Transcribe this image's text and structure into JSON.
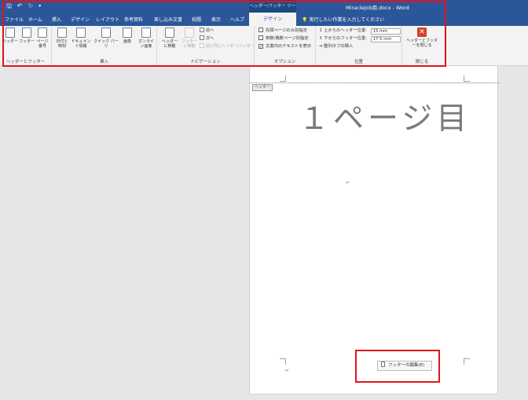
{
  "title_bar": {
    "context_tools_title": "ヘッダー/フッター ツール",
    "document_title": "MiracleJob用.docx  -  Word"
  },
  "tabs": [
    {
      "label": "ファイル"
    },
    {
      "label": "ホーム"
    },
    {
      "label": "挿入"
    },
    {
      "label": "デザイン"
    },
    {
      "label": "レイアウト"
    },
    {
      "label": "参考資料"
    },
    {
      "label": "差し込み文書"
    },
    {
      "label": "校閲"
    },
    {
      "label": "表示"
    },
    {
      "label": "ヘルプ"
    }
  ],
  "active_tab": {
    "label": "デザイン"
  },
  "tell_me": {
    "text": "実行したい作業を入力してください"
  },
  "ribbon": {
    "header_footer_group": {
      "label": "ヘッダーとフッター",
      "buttons": [
        {
          "label": "ヘッダー"
        },
        {
          "label": "フッター"
        },
        {
          "label": "ページ番号"
        }
      ]
    },
    "insert_group": {
      "label": "挿入",
      "buttons": [
        {
          "label": "日付と時刻"
        },
        {
          "label": "ドキュメント情報"
        },
        {
          "label": "クイック パーツ"
        },
        {
          "label": "画像"
        },
        {
          "label": "オンライン画像"
        }
      ]
    },
    "navigation_group": {
      "label": "ナビゲーション",
      "goto_header": "ヘッダーに移動",
      "goto_footer": "フッターに移動",
      "previous": "前へ",
      "next": "次へ",
      "link_previous": "前と同じヘッダー/フッター"
    },
    "options_group": {
      "label": "オプション",
      "first_page_different": "先頭ページのみ別指定",
      "odd_even_different": "奇数/偶数ページ別指定",
      "show_document_text": "文書内のテキストを表示"
    },
    "position_group": {
      "label": "位置",
      "header_from_top_label": "上からのヘッダー位置:",
      "header_from_top_value": "15 mm",
      "footer_from_bottom_label": "下からのフッター位置:",
      "footer_from_bottom_value": "17.5 mm",
      "insert_alignment_tab": "整列タブの挿入"
    },
    "close_group": {
      "label": "閉じる",
      "close_button": "ヘッダーとフッターを閉じる"
    }
  },
  "document": {
    "header_tag": "ヘッダー",
    "heading_text": "１ページ目",
    "footer_edit_button": "フッターの編集(E)"
  },
  "colors": {
    "word_blue": "#2b579a",
    "highlight_red": "#e0141b"
  }
}
